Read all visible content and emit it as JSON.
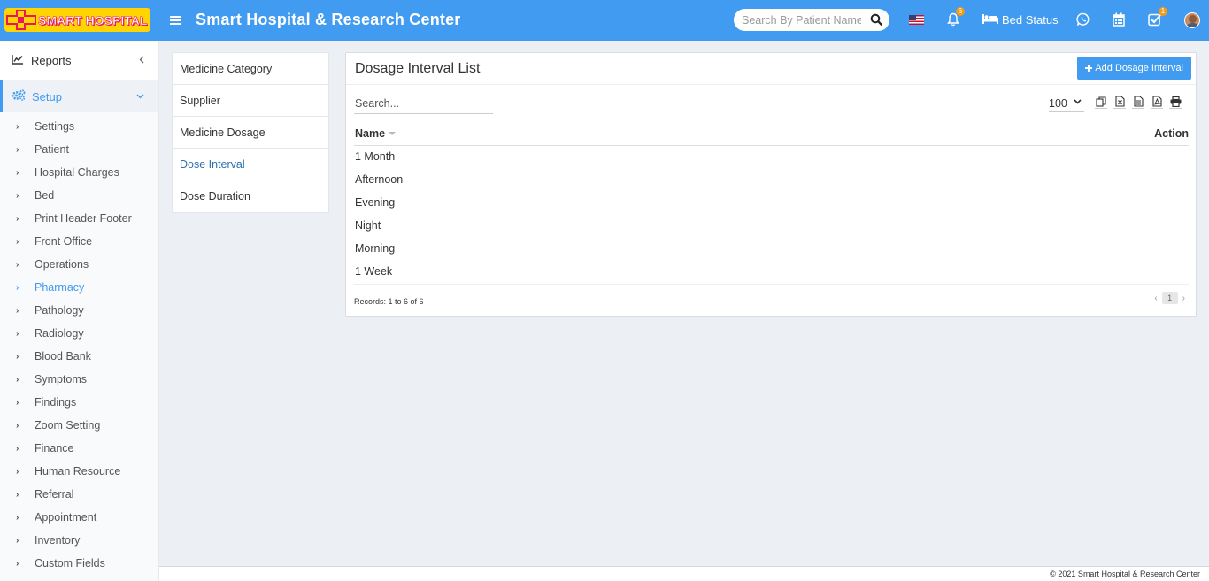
{
  "header": {
    "logo_text": "SMART HOSPITAL",
    "title": "Smart Hospital & Research Center",
    "search_placeholder": "Search By Patient Name",
    "notification_count": "6",
    "bed_status_label": "Bed Status",
    "task_count": "1",
    "accent_color": "#419bf0"
  },
  "sidebar": {
    "reports_label": "Reports",
    "setup_label": "Setup",
    "items": [
      {
        "label": "Settings"
      },
      {
        "label": "Patient"
      },
      {
        "label": "Hospital Charges"
      },
      {
        "label": "Bed"
      },
      {
        "label": "Print Header Footer"
      },
      {
        "label": "Front Office"
      },
      {
        "label": "Operations"
      },
      {
        "label": "Pharmacy"
      },
      {
        "label": "Pathology"
      },
      {
        "label": "Radiology"
      },
      {
        "label": "Blood Bank"
      },
      {
        "label": "Symptoms"
      },
      {
        "label": "Findings"
      },
      {
        "label": "Zoom Setting"
      },
      {
        "label": "Finance"
      },
      {
        "label": "Human Resource"
      },
      {
        "label": "Referral"
      },
      {
        "label": "Appointment"
      },
      {
        "label": "Inventory"
      },
      {
        "label": "Custom Fields"
      }
    ]
  },
  "submenu": {
    "items": [
      {
        "label": "Medicine Category"
      },
      {
        "label": "Supplier"
      },
      {
        "label": "Medicine Dosage"
      },
      {
        "label": "Dose Interval"
      },
      {
        "label": "Dose Duration"
      }
    ]
  },
  "main": {
    "title": "Dosage Interval List",
    "add_button": "Add Dosage Interval",
    "search_placeholder": "Search...",
    "page_length": "100",
    "columns": {
      "name": "Name",
      "action": "Action"
    },
    "rows": [
      {
        "name": "1 Month"
      },
      {
        "name": "Afternoon"
      },
      {
        "name": "Evening"
      },
      {
        "name": "Night"
      },
      {
        "name": "Morning"
      },
      {
        "name": "1 Week"
      }
    ],
    "records_text": "Records: 1 to 6 of 6",
    "current_page": "1"
  },
  "footer": {
    "copyright": "© 2021 Smart Hospital & Research Center"
  }
}
